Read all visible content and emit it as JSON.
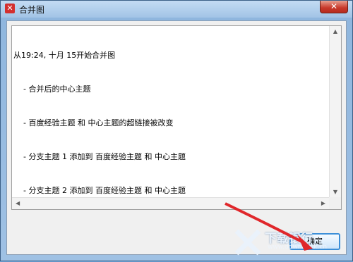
{
  "window": {
    "title": "合并图",
    "app_icon": "xmind-icon",
    "close_label": "✕"
  },
  "log": {
    "header": "从19:24, 十月 15开始合并图",
    "lines": [
      "- 合并后的中心主题",
      "- 百度经验主题 和 中心主题的超链接被改变",
      "- 分支主题 1 添加到 百度经验主题 和 中心主题",
      "- 分支主题 2 添加到 百度经验主题 和 中心主题"
    ]
  },
  "buttons": {
    "ok": "确定"
  },
  "watermark": {
    "text": "下载银行",
    "url": "www.downbank.cn"
  },
  "colors": {
    "arrow": "#e0272b",
    "titlebar": "#a2c4e6",
    "close": "#c8382a"
  }
}
